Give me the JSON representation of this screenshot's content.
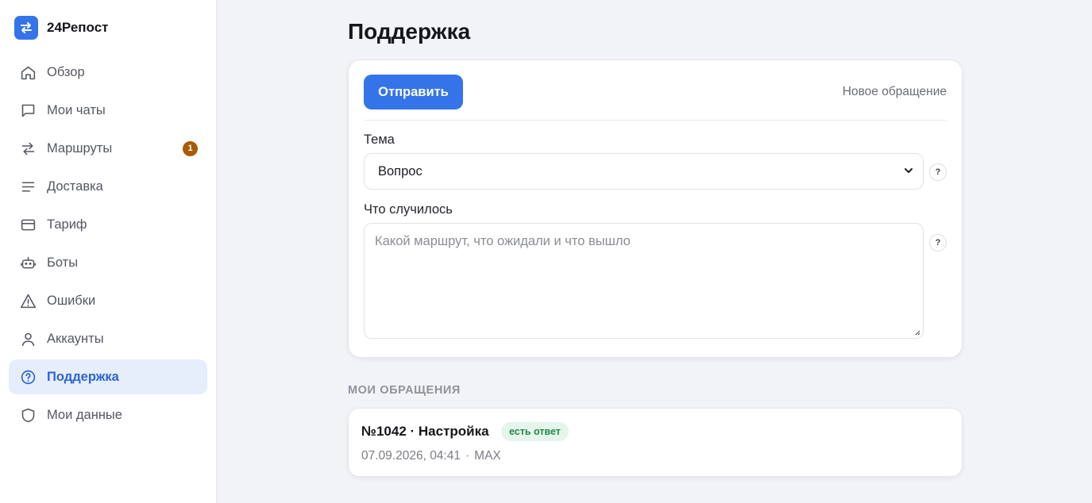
{
  "brand": {
    "name": "24Репост",
    "logo_icon": "swap-arrows-icon",
    "accent": "#3474e8"
  },
  "sidebar": {
    "items": [
      {
        "label": "Обзор",
        "icon": "home-icon"
      },
      {
        "label": "Мои чаты",
        "icon": "chat-icon"
      },
      {
        "label": "Маршруты",
        "icon": "swap-arrows-icon",
        "badge": "1"
      },
      {
        "label": "Доставка",
        "icon": "lines-icon"
      },
      {
        "label": "Тариф",
        "icon": "card-icon"
      },
      {
        "label": "Боты",
        "icon": "bot-icon"
      },
      {
        "label": "Ошибки",
        "icon": "warning-icon"
      },
      {
        "label": "Аккаунты",
        "icon": "user-icon"
      },
      {
        "label": "Поддержка",
        "icon": "help-circle-icon",
        "active": true
      },
      {
        "label": "Мои данные",
        "icon": "shield-icon"
      }
    ]
  },
  "page": {
    "title": "Поддержка"
  },
  "form": {
    "send_label": "Отправить",
    "new_request_label": "Новое обращение",
    "topic_label": "Тема",
    "topic_value": "Вопрос",
    "details_label": "Что случилось",
    "details_placeholder": "Какой маршрут, что ожидали и что вышло",
    "help_glyph": "?"
  },
  "requests": {
    "section_title": "МОИ ОБРАЩЕНИЯ",
    "items": [
      {
        "title": "№1042 · Настройка",
        "status": "есть ответ",
        "datetime": "07.09.2026, 04:41",
        "separator": "·",
        "channel": "MAX"
      }
    ]
  }
}
